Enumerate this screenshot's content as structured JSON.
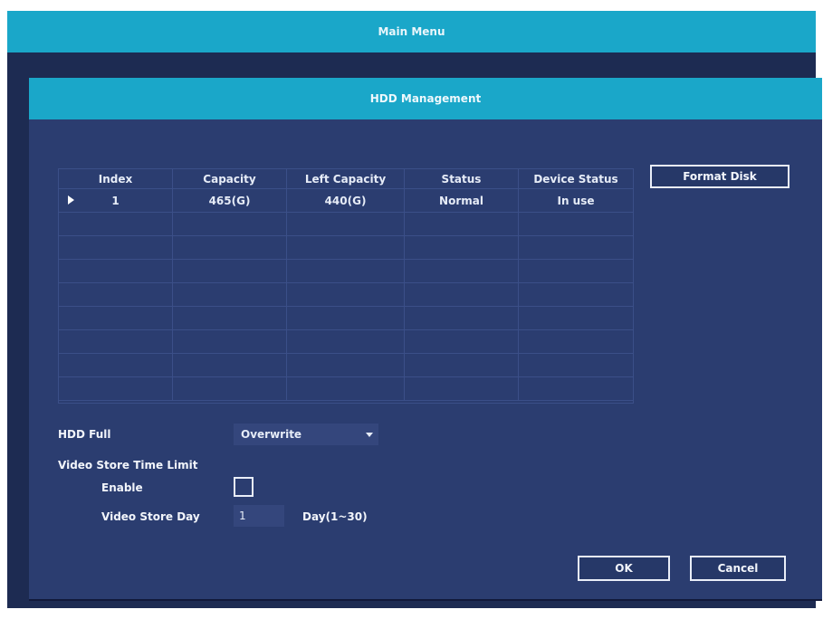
{
  "main_menu": {
    "title": "Main Menu"
  },
  "dialog": {
    "title": "HDD Management"
  },
  "table": {
    "columns": [
      "Index",
      "Capacity",
      "Left Capacity",
      "Status",
      "Device Status"
    ],
    "rows": [
      [
        "1",
        "465(G)",
        "440(G)",
        "Normal",
        "In use"
      ]
    ],
    "empty_row_count": 8
  },
  "format_button": "Format Disk",
  "hdd_full": {
    "label": "HDD Full",
    "value": "Overwrite"
  },
  "video_store_time_limit": {
    "label": "Video Store Time Limit",
    "enable_label": "Enable",
    "enabled": false,
    "day_label": "Video Store Day",
    "day_value": "1",
    "day_range": "Day(1~30)"
  },
  "buttons": {
    "ok": "OK",
    "cancel": "Cancel"
  },
  "colors": {
    "titlebar": "#1aa7c9",
    "panel": "#2b3d70",
    "window": "#1d2b52"
  }
}
